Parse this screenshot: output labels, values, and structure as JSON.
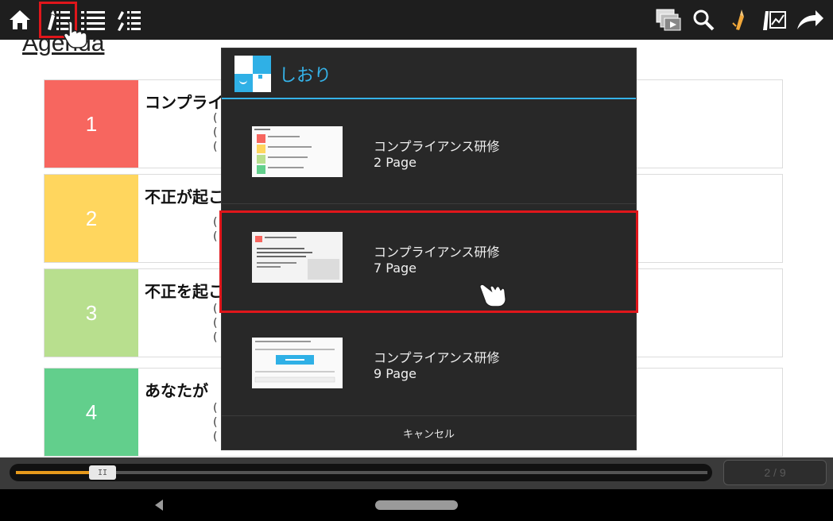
{
  "toolbar": {
    "left_icons": [
      "home-icon",
      "bookmark-list-icon",
      "table-of-contents-icon",
      "marker-list-icon"
    ],
    "right_icons": [
      "page-flip-icon",
      "search-icon",
      "marker-pen-icon",
      "annotation-icon",
      "share-icon"
    ]
  },
  "document": {
    "heading": "Agenda",
    "rows": [
      {
        "num": "1",
        "color": "#f7665f",
        "head": "コンプライ",
        "subs": [
          "(",
          "(",
          "("
        ]
      },
      {
        "num": "2",
        "color": "#ffd65e",
        "head": "不正が起こ",
        "subs": [
          "(",
          "("
        ]
      },
      {
        "num": "3",
        "color": "#b8df8e",
        "head": "不正を起こ",
        "subs": [
          "(",
          "(",
          "("
        ]
      },
      {
        "num": "4",
        "color": "#62cf8c",
        "head": "あなたが",
        "subs": [
          "(",
          "(",
          "("
        ]
      }
    ]
  },
  "dialog": {
    "title": "しおり",
    "brand_color": "#35b2e8",
    "bookmarks": [
      {
        "title": "コンプライアンス研修",
        "page": "2 Page"
      },
      {
        "title": "コンプライアンス研修",
        "page": "7 Page"
      },
      {
        "title": "コンプライアンス研修",
        "page": "9 Page"
      }
    ],
    "cancel_label": "キャンセル"
  },
  "slider": {
    "thumb_label": "II",
    "progress_percent": 12,
    "page_indicator": "2 / 9",
    "accent": "#e79a1c"
  }
}
